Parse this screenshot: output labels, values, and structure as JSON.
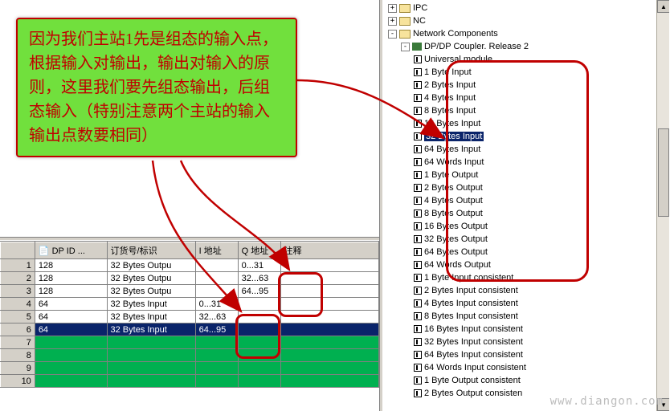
{
  "annotation": {
    "text": "因为我们主站1先是组态的输入点，根据输入对输出，输出对输入的原则，这里我们要先组态输出，后组态输入（特别注意两个主站的输入输出点数要相同）"
  },
  "watermark": "www.diangon.com",
  "table": {
    "headers": {
      "slot": "",
      "dpid": "DP ID",
      "order": "订货号/标识",
      "iaddr": "I 地址",
      "qaddr": "Q 地址",
      "comment": "注释"
    },
    "icon_label": "📄",
    "rows": [
      {
        "slot": "1",
        "dpid": "128",
        "order": "32 Bytes Outpu",
        "iaddr": "",
        "qaddr": "0...31",
        "comment": ""
      },
      {
        "slot": "2",
        "dpid": "128",
        "order": "32 Bytes Outpu",
        "iaddr": "",
        "qaddr": "32...63",
        "comment": ""
      },
      {
        "slot": "3",
        "dpid": "128",
        "order": "32 Bytes Outpu",
        "iaddr": "",
        "qaddr": "64...95",
        "comment": ""
      },
      {
        "slot": "4",
        "dpid": "64",
        "order": "32 Bytes Input",
        "iaddr": "0...31",
        "qaddr": "",
        "comment": ""
      },
      {
        "slot": "5",
        "dpid": "64",
        "order": "32 Bytes Input",
        "iaddr": "32...63",
        "qaddr": "",
        "comment": ""
      },
      {
        "slot": "6",
        "dpid": "64",
        "order": "32 Bytes Input",
        "iaddr": "64...95",
        "qaddr": "",
        "comment": "",
        "selected": true
      }
    ],
    "empty_rows": 4
  },
  "tree": {
    "top": [
      {
        "icon": "folder",
        "expander": "+",
        "label": "IPC"
      },
      {
        "icon": "folder",
        "expander": "+",
        "label": "NC"
      }
    ],
    "netcomp_label": "Network Components",
    "coupler_label": "DP/DP Coupler. Release 2",
    "highlighted_modules": [
      "Universal module",
      "1 Byte Input",
      "2 Bytes Input",
      "4 Bytes Input",
      "8 Bytes Input",
      "16 Bytes Input",
      "32 Bytes Input",
      "64 Bytes Input",
      "64 Words Input",
      "1 Byte Output",
      "2 Bytes Output",
      "4 Bytes Output",
      "8 Bytes Output",
      "16 Bytes Output",
      "32 Bytes Output",
      "64 Bytes Output",
      "64 Words Output"
    ],
    "selected_module": "32 Bytes Input",
    "rest_modules": [
      "1 Byte Input consistent",
      "2 Bytes Input consistent",
      "4 Bytes Input consistent",
      "8 Bytes Input consistent",
      "16 Bytes Input consistent",
      "32 Bytes Input consistent",
      "64 Bytes Input consistent",
      "64 Words Input consistent",
      "1 Byte Output consistent",
      "2 Bytes Output consisten"
    ]
  }
}
